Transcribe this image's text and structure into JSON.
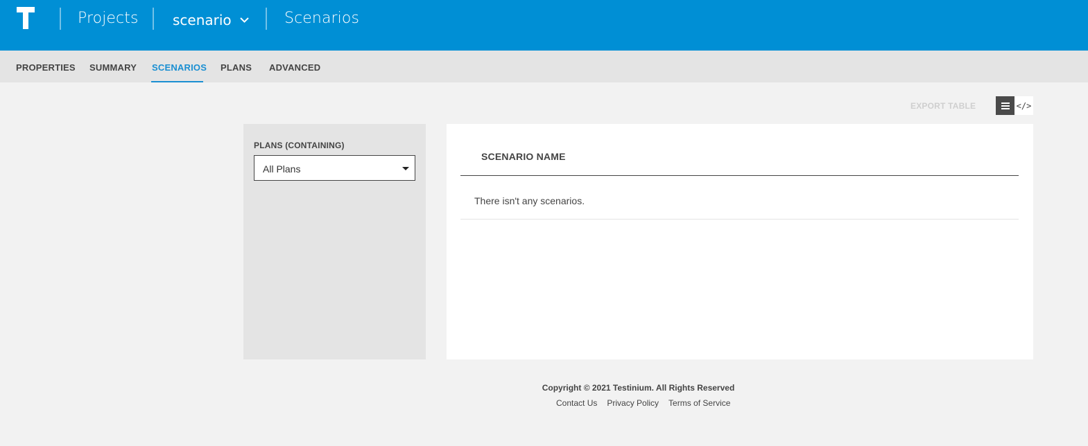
{
  "topbar": {
    "logo": "testinium-logo",
    "projects_link": "Projects",
    "project_selector": "scenario",
    "page_title": "Scenarios",
    "background_color": "#008fd5"
  },
  "tabs": [
    {
      "label": "PROPERTIES",
      "active": false
    },
    {
      "label": "SUMMARY",
      "active": false
    },
    {
      "label": "SCENARIOS",
      "active": true
    },
    {
      "label": "PLANS",
      "active": false
    },
    {
      "label": "ADVANCED",
      "active": false
    }
  ],
  "toolbar": {
    "export_label": "EXPORT TABLE",
    "view_list_icon": "list-icon",
    "view_code_icon": "code-icon",
    "view_code_glyph": "</>"
  },
  "filter": {
    "label": "PLANS (CONTAINING)",
    "selected": "All Plans"
  },
  "table": {
    "column": "SCENARIO NAME",
    "empty_message": "There isn't any scenarios."
  },
  "footer": {
    "copyright": "Copyright © 2021 Testinium. All Rights Reserved",
    "links": [
      "Contact Us",
      "Privacy Policy",
      "Terms of Service"
    ]
  },
  "colors": {
    "accent": "#1a8fd2",
    "panel_gray": "#e4e4e4",
    "page_bg": "#f2f2f2"
  }
}
